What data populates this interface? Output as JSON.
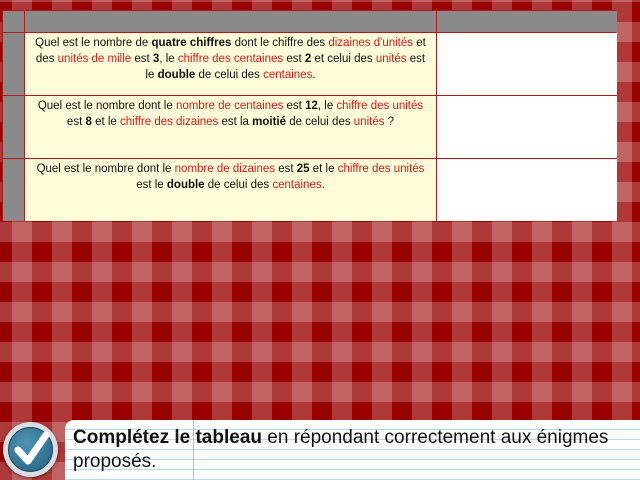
{
  "puzzles": [
    {
      "segments": [
        {
          "t": "Quel est le nombre de ",
          "s": "n"
        },
        {
          "t": "quatre chiffres",
          "s": "b"
        },
        {
          "t": " dont le chiffre des ",
          "s": "n"
        },
        {
          "t": "dizaines d'unités",
          "s": "r"
        },
        {
          "t": " et des ",
          "s": "n"
        },
        {
          "t": "unités de mille",
          "s": "r"
        },
        {
          "t": " est ",
          "s": "n"
        },
        {
          "t": "3",
          "s": "b"
        },
        {
          "t": ", le ",
          "s": "n"
        },
        {
          "t": "chiffre des centaines",
          "s": "r"
        },
        {
          "t": " est ",
          "s": "n"
        },
        {
          "t": "2",
          "s": "b"
        },
        {
          "t": " et celui des ",
          "s": "n"
        },
        {
          "t": "unités",
          "s": "r"
        },
        {
          "t": " est le ",
          "s": "n"
        },
        {
          "t": "double",
          "s": "b"
        },
        {
          "t": " de celui des ",
          "s": "n"
        },
        {
          "t": "centaines",
          "s": "r"
        },
        {
          "t": ".",
          "s": "n"
        }
      ],
      "answer": ""
    },
    {
      "segments": [
        {
          "t": "Quel est le nombre dont le ",
          "s": "n"
        },
        {
          "t": "nombre de centaines",
          "s": "r"
        },
        {
          "t": " est ",
          "s": "n"
        },
        {
          "t": "12",
          "s": "b"
        },
        {
          "t": ", le ",
          "s": "n"
        },
        {
          "t": "chiffre des unités",
          "s": "r"
        },
        {
          "t": " est ",
          "s": "n"
        },
        {
          "t": "8",
          "s": "b"
        },
        {
          "t": " et le ",
          "s": "n"
        },
        {
          "t": "chiffre des dizaines",
          "s": "r"
        },
        {
          "t": " est la ",
          "s": "n"
        },
        {
          "t": "moitié",
          "s": "b"
        },
        {
          "t": " de celui des ",
          "s": "n"
        },
        {
          "t": "unités",
          "s": "r"
        },
        {
          "t": " ?",
          "s": "n"
        }
      ],
      "answer": ""
    },
    {
      "segments": [
        {
          "t": "Quel est le nombre dont le ",
          "s": "n"
        },
        {
          "t": "nombre de dizaines",
          "s": "r"
        },
        {
          "t": " est ",
          "s": "n"
        },
        {
          "t": "25",
          "s": "b"
        },
        {
          "t": " et le ",
          "s": "n"
        },
        {
          "t": "chiffre des unités",
          "s": "r"
        },
        {
          "t": " est le ",
          "s": "n"
        },
        {
          "t": "double",
          "s": "b"
        },
        {
          "t": " de celui des ",
          "s": "n"
        },
        {
          "t": "centaines",
          "s": "r"
        },
        {
          "t": ".",
          "s": "n"
        }
      ],
      "answer": ""
    }
  ],
  "instruction": {
    "bold": "Complétez le tableau",
    "rest": " en répondant correctement aux énigmes proposés."
  },
  "icons": {
    "validate": "checkmark-icon"
  },
  "colors": {
    "highlight": "#d61818",
    "question_bg": "#fffcd9",
    "header_bg": "#8a8a8a",
    "grid_line": "#b01a1a",
    "background": "#990000"
  }
}
